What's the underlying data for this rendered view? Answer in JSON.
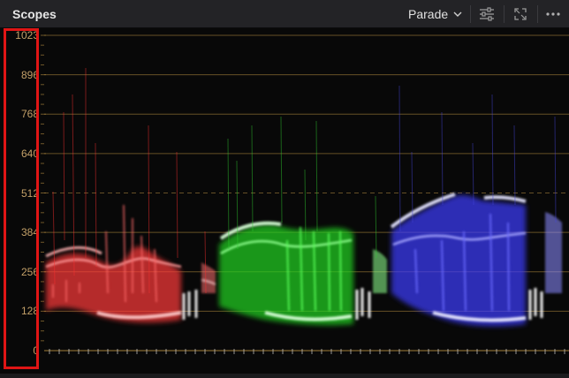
{
  "panel": {
    "title": "Scopes",
    "mode": "Parade",
    "icons": [
      "chevron-down-icon",
      "sliders-icon",
      "expand-icon",
      "more-icon"
    ]
  },
  "axis": {
    "labels": [
      "1023",
      "896",
      "768",
      "640",
      "512",
      "384",
      "256",
      "128",
      "0"
    ]
  },
  "colors": {
    "grid": "#b38b3f",
    "label": "#c3a068",
    "red": "#ff5858",
    "green": "#3cff3c",
    "blue": "#6a6aff",
    "highlight": "#e01515"
  }
}
